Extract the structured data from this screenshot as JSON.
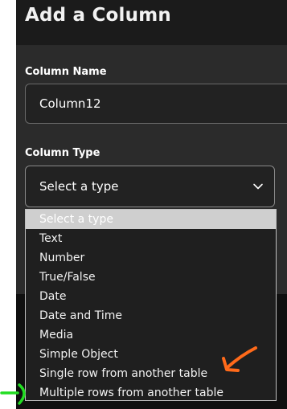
{
  "dialog": {
    "title": "Add a Column"
  },
  "form": {
    "column_name_label": "Column Name",
    "column_name_value": "Column12",
    "column_type_label": "Column Type",
    "column_type_selected": "Select a type"
  },
  "dropdown": {
    "options": [
      "Select a type",
      "Text",
      "Number",
      "True/False",
      "Date",
      "Date and Time",
      "Media",
      "Simple Object",
      "Single row from another table",
      "Multiple rows from another table"
    ],
    "selected_index": 0
  },
  "icons": {
    "select_chevron": "chevron-down-icon",
    "annotation_orange": "arrow-icon",
    "annotation_green": "arrow-icon"
  },
  "colors": {
    "orange_annotation": "#ff6a1a",
    "green_annotation": "#22dd22",
    "highlight": "#cfcfcf"
  }
}
